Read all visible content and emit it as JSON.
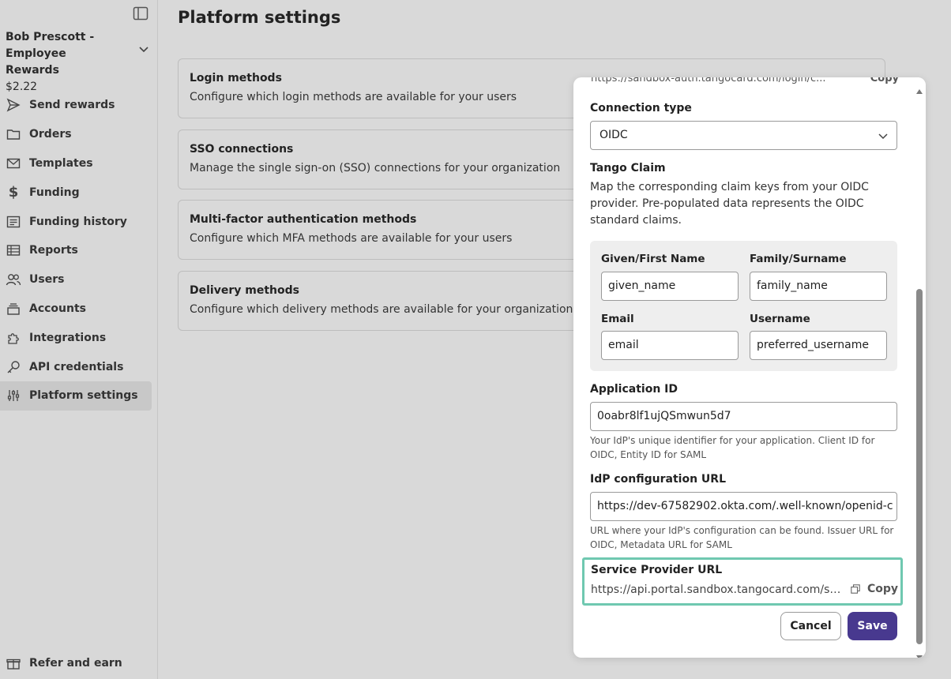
{
  "sidebar": {
    "account_name": "Bob Prescott - Employee Rewards",
    "account_balance": "$2.22",
    "items": [
      {
        "label": "Send rewards"
      },
      {
        "label": "Orders"
      },
      {
        "label": "Templates"
      },
      {
        "label": "Funding"
      },
      {
        "label": "Funding history"
      },
      {
        "label": "Reports"
      },
      {
        "label": "Users"
      },
      {
        "label": "Accounts"
      },
      {
        "label": "Integrations"
      },
      {
        "label": "API credentials"
      },
      {
        "label": "Platform settings",
        "active": true
      }
    ],
    "footer_label": "Refer and earn"
  },
  "main": {
    "title": "Platform settings",
    "cards": [
      {
        "title": "Login methods",
        "description": "Configure which login methods are available for your users"
      },
      {
        "title": "SSO connections",
        "description": "Manage the single sign-on (SSO) connections for your organization"
      },
      {
        "title": "Multi-factor authentication methods",
        "description": "Configure which MFA methods are available for your users"
      },
      {
        "title": "Delivery methods",
        "description": "Configure which delivery methods are available for your organization"
      }
    ]
  },
  "panel": {
    "cutoff_text": "https://sandbox-auth.tangocard.com/login/c...",
    "cutoff_copy": "Copy",
    "connection_type_label": "Connection type",
    "connection_type_value": "OIDC",
    "tango_claim_label": "Tango Claim",
    "tango_claim_desc": "Map the corresponding claim keys from your OIDC provider. Pre-populated data represents the OIDC standard claims.",
    "claims": {
      "given_label": "Given/First Name",
      "given_value": "given_name",
      "family_label": "Family/Surname",
      "family_value": "family_name",
      "email_label": "Email",
      "email_value": "email",
      "username_label": "Username",
      "username_value": "preferred_username"
    },
    "application_id_label": "Application ID",
    "application_id_value": "0oabr8lf1ujQSmwun5d7",
    "application_id_hint": "Your IdP's unique identifier for your application. Client ID for OIDC, Entity ID for SAML",
    "idp_url_label": "IdP configuration URL",
    "idp_url_value": "https://dev-67582902.okta.com/.well-known/openid-c",
    "idp_url_hint": "URL where your IdP's configuration can be found. Issuer URL for OIDC, Metadata URL for SAML",
    "sp_url_label": "Service Provider URL",
    "sp_url_value": "https://api.portal.sandbox.tangocard.com/si...",
    "sp_copy_label": "Copy",
    "cancel_label": "Cancel",
    "save_label": "Save"
  },
  "colors": {
    "primary": "#48398f",
    "highlight": "#6fc8b0",
    "background": "#d9d9d9"
  },
  "icons": [
    "sidebar-toggle-icon",
    "chevron-down-icon",
    "send-icon",
    "folder-icon",
    "mail-icon",
    "dollar-icon",
    "list-icon",
    "table-icon",
    "users-icon",
    "stack-icon",
    "puzzle-icon",
    "key-icon",
    "sliders-icon",
    "gift-icon",
    "copy-icon"
  ]
}
